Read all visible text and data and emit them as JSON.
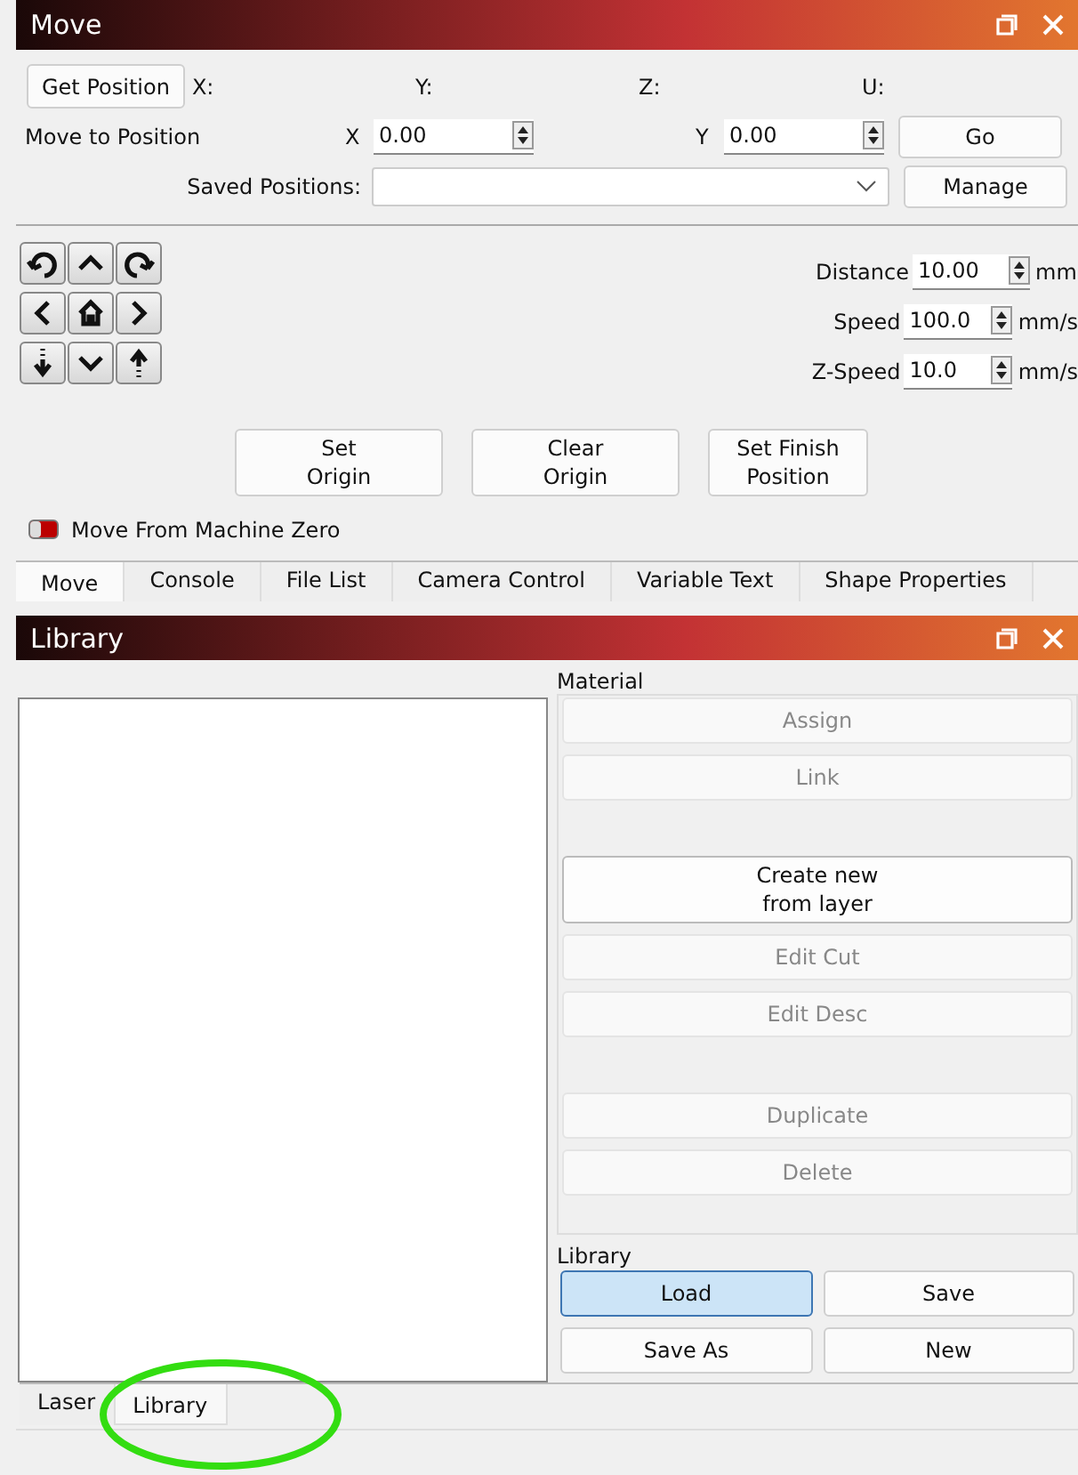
{
  "move_panel": {
    "title": "Move",
    "get_position_button": "Get Position",
    "axes": [
      {
        "label": "X:"
      },
      {
        "label": "Y:"
      },
      {
        "label": "Z:"
      },
      {
        "label": "U:"
      }
    ],
    "move_to_label": "Move to Position",
    "position_fields": [
      {
        "label": "X",
        "value": "0.00"
      },
      {
        "label": "Y",
        "value": "0.00"
      }
    ],
    "go_button": "Go",
    "saved_positions_label": "Saved Positions:",
    "manage_button": "Manage",
    "jog_buttons": [
      {
        "kind": "rotate-ccw"
      },
      {
        "kind": "up"
      },
      {
        "kind": "rotate-cw"
      },
      {
        "kind": "left"
      },
      {
        "kind": "home"
      },
      {
        "kind": "right"
      },
      {
        "kind": "z-down"
      },
      {
        "kind": "down"
      },
      {
        "kind": "z-up"
      }
    ],
    "settings": [
      {
        "label": "Distance",
        "value": "10.00",
        "unit": "mm"
      },
      {
        "label": "Speed",
        "value": "100.0",
        "unit": "mm/s"
      },
      {
        "label": "Z-Speed",
        "value": "10.0",
        "unit": "mm/s"
      }
    ],
    "origin_buttons": [
      {
        "line1": "Set",
        "line2": "Origin"
      },
      {
        "line1": "Clear",
        "line2": "Origin"
      },
      {
        "line1": "Set Finish",
        "line2": "Position"
      }
    ],
    "move_from_machine_zero": {
      "label": "Move From Machine Zero",
      "on": false
    },
    "tabs": [
      {
        "label": "Move",
        "selected": true
      },
      {
        "label": "Console",
        "selected": false
      },
      {
        "label": "File List",
        "selected": false
      },
      {
        "label": "Camera Control",
        "selected": false
      },
      {
        "label": "Variable Text",
        "selected": false
      },
      {
        "label": "Shape Properties",
        "selected": false
      }
    ]
  },
  "library_panel": {
    "title": "Library",
    "material_group": "Material",
    "material_buttons": [
      {
        "line1": "Assign",
        "disabled": true,
        "gap_before": false
      },
      {
        "line1": "Link",
        "disabled": true,
        "gap_before": false
      },
      {
        "line1": "Create new",
        "line2": "from layer",
        "disabled": false,
        "gap_before": true
      },
      {
        "line1": "Edit Cut",
        "disabled": true,
        "gap_before": false
      },
      {
        "line1": "Edit Desc",
        "disabled": true,
        "gap_before": false
      },
      {
        "line1": "Duplicate",
        "disabled": true,
        "gap_before": true
      },
      {
        "line1": "Delete",
        "disabled": true,
        "gap_before": false
      }
    ],
    "library_group": "Library",
    "library_buttons": [
      {
        "label": "Load",
        "selected": true
      },
      {
        "label": "Save",
        "selected": false
      },
      {
        "label": "Save As",
        "selected": false
      },
      {
        "label": "New",
        "selected": false
      }
    ],
    "bottom_tabs": [
      {
        "label": "Laser",
        "selected": false
      },
      {
        "label": "Library",
        "selected": true
      }
    ]
  },
  "highlight": {
    "kind": "ellipse"
  }
}
